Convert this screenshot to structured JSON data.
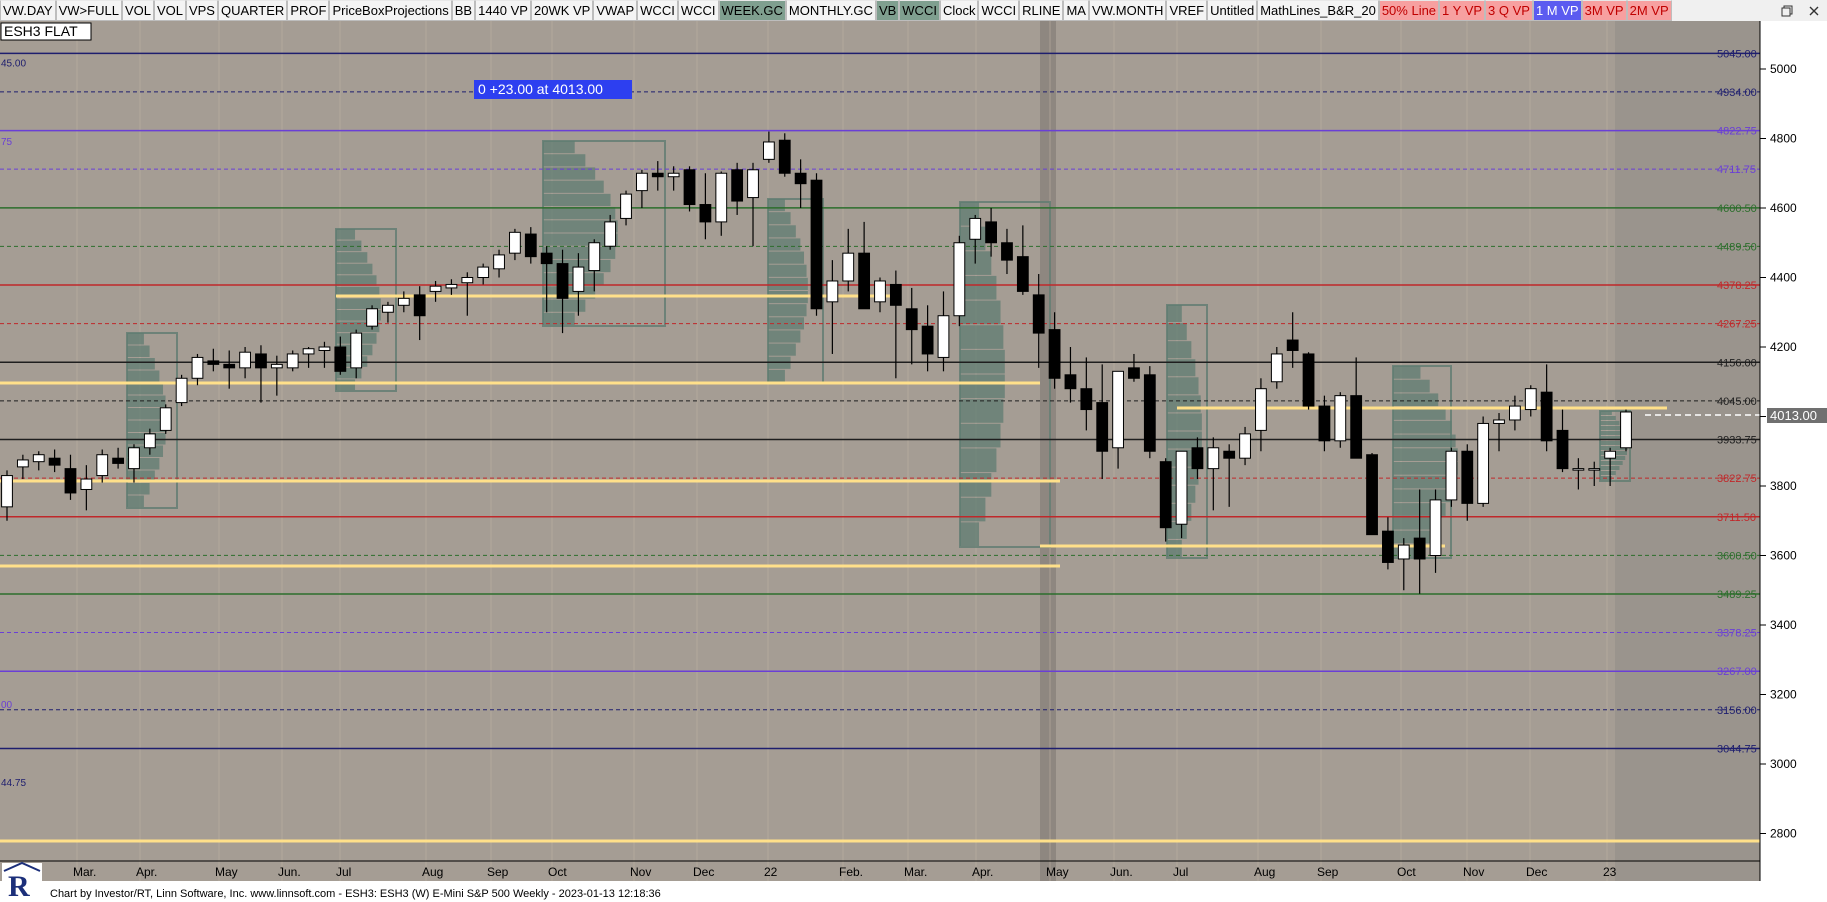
{
  "toolbar": {
    "items": [
      {
        "label": "VW.DAY",
        "bg": "#f4f4f4"
      },
      {
        "label": "VW>FULL",
        "bg": "#f4f4f4"
      },
      {
        "label": "VOL",
        "bg": "#f4f4f4"
      },
      {
        "label": "VOL",
        "bg": "#f4f4f4"
      },
      {
        "label": "VPS",
        "bg": "#f4f4f4"
      },
      {
        "label": "QUARTER",
        "bg": "#f4f4f4"
      },
      {
        "label": "PROF",
        "bg": "#f4f4f4"
      },
      {
        "label": "PriceBoxProjections",
        "bg": "#f4f4f4"
      },
      {
        "label": "BB",
        "bg": "#f4f4f4"
      },
      {
        "label": "1440 VP",
        "bg": "#f4f4f4"
      },
      {
        "label": "20WK VP",
        "bg": "#f4f4f4"
      },
      {
        "label": "VWAP",
        "bg": "#f4f4f4"
      },
      {
        "label": "WCCI",
        "bg": "#f4f4f4"
      },
      {
        "label": "WCCI",
        "bg": "#f4f4f4"
      },
      {
        "label": "WEEK.GC",
        "bg": "#7f9f8f"
      },
      {
        "label": "MONTHLY.GC",
        "bg": "#f4f4f4"
      },
      {
        "label": "VB",
        "bg": "#7f9f8f"
      },
      {
        "label": "WCCI",
        "bg": "#7f9f8f"
      },
      {
        "label": "Clock",
        "bg": "#f4f4f4"
      },
      {
        "label": "WCCI",
        "bg": "#f4f4f4"
      },
      {
        "label": "RLINE",
        "bg": "#f4f4f4"
      },
      {
        "label": "MA",
        "bg": "#f4f4f4"
      },
      {
        "label": "VW.MONTH",
        "bg": "#f4f4f4"
      },
      {
        "label": "VREF",
        "bg": "#f4f4f4"
      },
      {
        "label": "Untitled",
        "bg": "#f4f4f4"
      },
      {
        "label": "MathLines_B&R_20",
        "bg": "#f4f4f4"
      },
      {
        "label": "50% Line",
        "bg": "#f7a0a0",
        "color": "#c00000"
      },
      {
        "label": "1 Y VP",
        "bg": "#f7a0a0",
        "color": "#c00000"
      },
      {
        "label": "3 Q VP",
        "bg": "#f7a0a0",
        "color": "#c00000"
      },
      {
        "label": "1 M VP",
        "bg": "#5b5bf0",
        "color": "#ffffff"
      },
      {
        "label": "3M VP",
        "bg": "#f7a0a0",
        "color": "#c00000"
      },
      {
        "label": "2M VP",
        "bg": "#f7a0a0",
        "color": "#c00000"
      }
    ],
    "window_controls": [
      "restore",
      "close"
    ]
  },
  "chart": {
    "symbol_label": "ESH3 FLAT",
    "change_label": "0  +23.00 at 4013.00",
    "last_price_tag": "4013.00",
    "footer": "Chart by Investor/RT, Linn Software, Inc. www.linnsoft.com - ESH3: ESH3 (W) E-Mini S&P 500 Weekly - 2023-01-13 12:18:36",
    "colors": {
      "background": "#a59d94",
      "up_candle": "#ffffff",
      "down_candle": "#000000",
      "volume_profile": "#5f7c71",
      "highlight_line": "#ffe08a",
      "level_red": "#c0282a",
      "level_purple": "#6a3fd6",
      "level_green": "#2c6e2c",
      "level_navy": "#1e1e6e"
    }
  },
  "chart_data": {
    "type": "candlestick",
    "title": "ESH3: ESH3 (W) E-Mini S&P 500 Weekly",
    "y_ticks": [
      5000,
      4800,
      4600,
      4400,
      4200,
      4000,
      3800,
      3600,
      3400,
      3200,
      3000,
      2800
    ],
    "ylim": [
      2760,
      5090
    ],
    "x_ticks": [
      "Mar.",
      "Apr.",
      "May",
      "Jun.",
      "Jul",
      "Aug",
      "Sep",
      "Oct",
      "Nov",
      "Dec",
      "22",
      "Feb.",
      "Mar.",
      "Apr.",
      "May",
      "Jun.",
      "Jul",
      "Aug",
      "Sep",
      "Oct",
      "Nov",
      "Dec",
      "23"
    ],
    "math_lines": [
      {
        "value": 5045.0,
        "label": "5045.00",
        "color": "#1e1e6e",
        "style": "solid"
      },
      {
        "value": 4934.0,
        "label": "4934.00",
        "color": "#1e1e6e",
        "style": "dashed"
      },
      {
        "value": 4822.75,
        "label": "4822.75",
        "color": "#6a3fd6",
        "style": "solid"
      },
      {
        "value": 4711.75,
        "label": "4711.75",
        "color": "#6a3fd6",
        "style": "dashed"
      },
      {
        "value": 4600.5,
        "label": "4600.50",
        "color": "#2c6e2c",
        "style": "solid"
      },
      {
        "value": 4489.5,
        "label": "4489.50",
        "color": "#2c6e2c",
        "style": "dashed"
      },
      {
        "value": 4378.25,
        "label": "4378.25",
        "color": "#c0282a",
        "style": "solid"
      },
      {
        "value": 4267.25,
        "label": "4267.25",
        "color": "#c0282a",
        "style": "dashed"
      },
      {
        "value": 4156.0,
        "label": "4156.00",
        "color": "#1e1e1e",
        "style": "solid"
      },
      {
        "value": 4045.0,
        "label": "4045.00",
        "color": "#1e1e1e",
        "style": "dashed"
      },
      {
        "value": 3933.75,
        "label": "3933.75",
        "color": "#1e1e1e",
        "style": "solid"
      },
      {
        "value": 3822.75,
        "label": "3822.75",
        "color": "#c0282a",
        "style": "dashed"
      },
      {
        "value": 3711.5,
        "label": "3711.50",
        "color": "#c0282a",
        "style": "solid"
      },
      {
        "value": 3600.5,
        "label": "3600.50",
        "color": "#2c6e2c",
        "style": "dashed"
      },
      {
        "value": 3489.25,
        "label": "3489.25",
        "color": "#2c6e2c",
        "style": "solid"
      },
      {
        "value": 3378.25,
        "label": "3378.25",
        "color": "#6a3fd6",
        "style": "dashed"
      },
      {
        "value": 3267.0,
        "label": "3267.00",
        "color": "#6a3fd6",
        "style": "solid"
      },
      {
        "value": 3156.0,
        "label": "3156.00",
        "color": "#1e1e6e",
        "style": "dashed"
      },
      {
        "value": 3044.75,
        "label": "3044.75",
        "color": "#1e1e6e",
        "style": "solid"
      }
    ],
    "left_edge_labels": [
      "45.00",
      "75",
      "00",
      "44.75"
    ],
    "candles": [
      {
        "o": 3740,
        "h": 3845,
        "l": 3700,
        "c": 3830
      },
      {
        "o": 3855,
        "h": 3890,
        "l": 3820,
        "c": 3875
      },
      {
        "o": 3870,
        "h": 3900,
        "l": 3845,
        "c": 3890
      },
      {
        "o": 3880,
        "h": 3905,
        "l": 3840,
        "c": 3860
      },
      {
        "o": 3850,
        "h": 3890,
        "l": 3760,
        "c": 3780
      },
      {
        "o": 3790,
        "h": 3860,
        "l": 3730,
        "c": 3820
      },
      {
        "o": 3830,
        "h": 3905,
        "l": 3810,
        "c": 3890
      },
      {
        "o": 3880,
        "h": 3910,
        "l": 3850,
        "c": 3865
      },
      {
        "o": 3850,
        "h": 3920,
        "l": 3810,
        "c": 3910
      },
      {
        "o": 3910,
        "h": 3965,
        "l": 3890,
        "c": 3950
      },
      {
        "o": 3960,
        "h": 4035,
        "l": 3950,
        "c": 4025
      },
      {
        "o": 4040,
        "h": 4120,
        "l": 4030,
        "c": 4110
      },
      {
        "o": 4110,
        "h": 4180,
        "l": 4090,
        "c": 4170
      },
      {
        "o": 4160,
        "h": 4195,
        "l": 4130,
        "c": 4150
      },
      {
        "o": 4150,
        "h": 4190,
        "l": 4080,
        "c": 4140
      },
      {
        "o": 4140,
        "h": 4200,
        "l": 4110,
        "c": 4185
      },
      {
        "o": 4180,
        "h": 4205,
        "l": 4040,
        "c": 4140
      },
      {
        "o": 4140,
        "h": 4175,
        "l": 4060,
        "c": 4150
      },
      {
        "o": 4140,
        "h": 4190,
        "l": 4130,
        "c": 4180
      },
      {
        "o": 4180,
        "h": 4200,
        "l": 4140,
        "c": 4195
      },
      {
        "o": 4190,
        "h": 4215,
        "l": 4140,
        "c": 4200
      },
      {
        "o": 4200,
        "h": 4230,
        "l": 4120,
        "c": 4130
      },
      {
        "o": 4140,
        "h": 4250,
        "l": 4110,
        "c": 4240
      },
      {
        "o": 4260,
        "h": 4320,
        "l": 4250,
        "c": 4310
      },
      {
        "o": 4300,
        "h": 4330,
        "l": 4270,
        "c": 4320
      },
      {
        "o": 4320,
        "h": 4360,
        "l": 4300,
        "c": 4340
      },
      {
        "o": 4350,
        "h": 4375,
        "l": 4220,
        "c": 4290
      },
      {
        "o": 4360,
        "h": 4390,
        "l": 4330,
        "c": 4375
      },
      {
        "o": 4370,
        "h": 4395,
        "l": 4350,
        "c": 4380
      },
      {
        "o": 4385,
        "h": 4415,
        "l": 4290,
        "c": 4400
      },
      {
        "o": 4400,
        "h": 4440,
        "l": 4380,
        "c": 4430
      },
      {
        "o": 4425,
        "h": 4480,
        "l": 4400,
        "c": 4465
      },
      {
        "o": 4470,
        "h": 4540,
        "l": 4450,
        "c": 4530
      },
      {
        "o": 4525,
        "h": 4545,
        "l": 4440,
        "c": 4460
      },
      {
        "o": 4470,
        "h": 4490,
        "l": 4300,
        "c": 4440
      },
      {
        "o": 4440,
        "h": 4480,
        "l": 4240,
        "c": 4340
      },
      {
        "o": 4360,
        "h": 4470,
        "l": 4290,
        "c": 4430
      },
      {
        "o": 4420,
        "h": 4510,
        "l": 4360,
        "c": 4500
      },
      {
        "o": 4490,
        "h": 4580,
        "l": 4480,
        "c": 4560
      },
      {
        "o": 4570,
        "h": 4650,
        "l": 4550,
        "c": 4640
      },
      {
        "o": 4650,
        "h": 4710,
        "l": 4600,
        "c": 4700
      },
      {
        "o": 4700,
        "h": 4735,
        "l": 4650,
        "c": 4690
      },
      {
        "o": 4690,
        "h": 4720,
        "l": 4650,
        "c": 4700
      },
      {
        "o": 4710,
        "h": 4720,
        "l": 4590,
        "c": 4610
      },
      {
        "o": 4610,
        "h": 4700,
        "l": 4510,
        "c": 4560
      },
      {
        "o": 4560,
        "h": 4705,
        "l": 4520,
        "c": 4700
      },
      {
        "o": 4710,
        "h": 4730,
        "l": 4580,
        "c": 4620
      },
      {
        "o": 4630,
        "h": 4730,
        "l": 4490,
        "c": 4710
      },
      {
        "o": 4740,
        "h": 4820,
        "l": 4730,
        "c": 4790
      },
      {
        "o": 4795,
        "h": 4815,
        "l": 4690,
        "c": 4700
      },
      {
        "o": 4700,
        "h": 4740,
        "l": 4600,
        "c": 4670
      },
      {
        "o": 4680,
        "h": 4700,
        "l": 4290,
        "c": 4310
      },
      {
        "o": 4330,
        "h": 4450,
        "l": 4180,
        "c": 4390
      },
      {
        "o": 4390,
        "h": 4540,
        "l": 4360,
        "c": 4470
      },
      {
        "o": 4470,
        "h": 4560,
        "l": 4310,
        "c": 4310
      },
      {
        "o": 4330,
        "h": 4400,
        "l": 4300,
        "c": 4390
      },
      {
        "o": 4380,
        "h": 4420,
        "l": 4110,
        "c": 4320
      },
      {
        "o": 4310,
        "h": 4370,
        "l": 4150,
        "c": 4250
      },
      {
        "o": 4260,
        "h": 4320,
        "l": 4130,
        "c": 4180
      },
      {
        "o": 4170,
        "h": 4360,
        "l": 4130,
        "c": 4290
      },
      {
        "o": 4290,
        "h": 4520,
        "l": 4260,
        "c": 4500
      },
      {
        "o": 4510,
        "h": 4580,
        "l": 4440,
        "c": 4570
      },
      {
        "o": 4560,
        "h": 4600,
        "l": 4460,
        "c": 4500
      },
      {
        "o": 4500,
        "h": 4540,
        "l": 4410,
        "c": 4450
      },
      {
        "o": 4460,
        "h": 4550,
        "l": 4350,
        "c": 4360
      },
      {
        "o": 4350,
        "h": 4410,
        "l": 4140,
        "c": 4240
      },
      {
        "o": 4250,
        "h": 4300,
        "l": 4080,
        "c": 4110
      },
      {
        "o": 4120,
        "h": 4200,
        "l": 4040,
        "c": 4080
      },
      {
        "o": 4080,
        "h": 4170,
        "l": 3960,
        "c": 4020
      },
      {
        "o": 4040,
        "h": 4150,
        "l": 3820,
        "c": 3900
      },
      {
        "o": 3910,
        "h": 4130,
        "l": 3850,
        "c": 4130
      },
      {
        "o": 4140,
        "h": 4180,
        "l": 4100,
        "c": 4110
      },
      {
        "o": 4120,
        "h": 4145,
        "l": 3880,
        "c": 3900
      },
      {
        "o": 3870,
        "h": 3880,
        "l": 3640,
        "c": 3680
      },
      {
        "o": 3690,
        "h": 3900,
        "l": 3650,
        "c": 3900
      },
      {
        "o": 3910,
        "h": 3940,
        "l": 3820,
        "c": 3850
      },
      {
        "o": 3850,
        "h": 3940,
        "l": 3730,
        "c": 3910
      },
      {
        "o": 3900,
        "h": 3920,
        "l": 3740,
        "c": 3880
      },
      {
        "o": 3880,
        "h": 3970,
        "l": 3860,
        "c": 3950
      },
      {
        "o": 3960,
        "h": 4110,
        "l": 3900,
        "c": 4080
      },
      {
        "o": 4100,
        "h": 4200,
        "l": 4080,
        "c": 4180
      },
      {
        "o": 4220,
        "h": 4300,
        "l": 4140,
        "c": 4190
      },
      {
        "o": 4180,
        "h": 4185,
        "l": 4020,
        "c": 4030
      },
      {
        "o": 4030,
        "h": 4060,
        "l": 3900,
        "c": 3930
      },
      {
        "o": 3930,
        "h": 4070,
        "l": 3910,
        "c": 4060
      },
      {
        "o": 4060,
        "h": 4170,
        "l": 3880,
        "c": 3880
      },
      {
        "o": 3890,
        "h": 3895,
        "l": 3660,
        "c": 3660
      },
      {
        "o": 3670,
        "h": 3710,
        "l": 3560,
        "c": 3580
      },
      {
        "o": 3590,
        "h": 3650,
        "l": 3500,
        "c": 3630
      },
      {
        "o": 3650,
        "h": 3790,
        "l": 3490,
        "c": 3590
      },
      {
        "o": 3600,
        "h": 3790,
        "l": 3550,
        "c": 3760
      },
      {
        "o": 3760,
        "h": 3910,
        "l": 3740,
        "c": 3900
      },
      {
        "o": 3900,
        "h": 3920,
        "l": 3700,
        "c": 3750
      },
      {
        "o": 3750,
        "h": 4000,
        "l": 3740,
        "c": 3980
      },
      {
        "o": 3980,
        "h": 4010,
        "l": 3900,
        "c": 3990
      },
      {
        "o": 3990,
        "h": 4060,
        "l": 3960,
        "c": 4030
      },
      {
        "o": 4020,
        "h": 4090,
        "l": 4000,
        "c": 4080
      },
      {
        "o": 4070,
        "h": 4150,
        "l": 3900,
        "c": 3930
      },
      {
        "o": 3960,
        "h": 4020,
        "l": 3840,
        "c": 3850
      },
      {
        "o": 3850,
        "h": 3880,
        "l": 3790,
        "c": 3850
      },
      {
        "o": 3850,
        "h": 3870,
        "l": 3800,
        "c": 3850
      },
      {
        "o": 3880,
        "h": 3910,
        "l": 3800,
        "c": 3900
      },
      {
        "o": 3910,
        "h": 4020,
        "l": 3900,
        "c": 4013
      }
    ]
  }
}
